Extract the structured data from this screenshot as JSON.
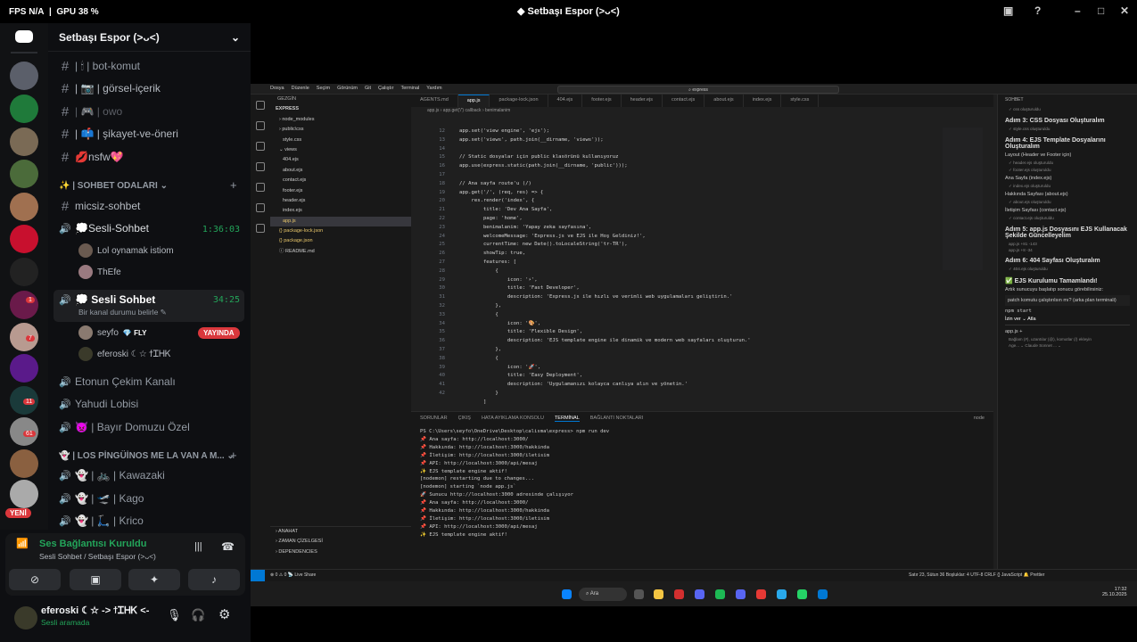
{
  "titlebar": {
    "fps_label": "FPS  N/A",
    "gpu_label": "GPU  38 %",
    "window_title": "Setbaşı Espor (>ᴗ<)"
  },
  "server": {
    "name": "Setbaşı Espor (>ᴗ<)",
    "badges": [
      "1",
      "7",
      "11",
      "61"
    ],
    "new_label": "YENİ"
  },
  "channels": {
    "text": [
      {
        "name": "| 🕯 | bot-komut",
        "dim": false
      },
      {
        "name": "| 📷 | görsel-içerik",
        "dim": false
      },
      {
        "name": "| 🎮 | owo",
        "dim": true
      },
      {
        "name": "| 📫 | şikayet-ve-öneri",
        "dim": false
      },
      {
        "name": "💋nsfw💖",
        "dim": false
      }
    ],
    "category1": "✨ | SOHBET ODALARI",
    "micsiz": "micsiz-sohbet",
    "voice1": {
      "name": "💭Sesli-Sohbet",
      "timer": "1:36:03",
      "users": [
        "Lol oynamak istiom",
        "ThEfe"
      ]
    },
    "voice2": {
      "name": "💭 Sesli Sohbet",
      "timer": "34:25",
      "status": "Bir kanal durumu belirle",
      "users": [
        {
          "name": "seyfo",
          "badge": "💎 FLY",
          "live": "YAYINDA"
        },
        {
          "name": "eferoski ☾☆ ϯᏆᎻᏦ"
        }
      ]
    },
    "others": [
      "Etonun Çekim Kanalı",
      "Yahudi Lobisi",
      "👿 | Bayır Domuzu Özel"
    ],
    "category2": "👻 | LOS PİNGÜİNOS ME LA VAN A M...",
    "pingu": [
      "👻 | 🚲 | Kawazaki",
      "👻 | 🛫 | Kago",
      "👻 | 🛴 | Krico"
    ]
  },
  "voice_panel": {
    "status": "Ses Bağlantısı Kuruldu",
    "channel": "Sesli Sohbet / Setbaşı Espor (>ᴗ<)"
  },
  "user": {
    "name": "eferoski ☾☆ -> ϯᏆᎻᏦ <-",
    "status": "Sesli aramada"
  },
  "vscode": {
    "menu": [
      "Dosya",
      "Düzenle",
      "Seçim",
      "Görünüm",
      "Git",
      "Çalıştır",
      "Terminal",
      "Yardım"
    ],
    "search": "express",
    "explorer_title": "GEZGİN",
    "tree": [
      "EXPRESS",
      "› node_modules",
      "› public\\css",
      "   style.css",
      "⌄ views",
      "   404.ejs",
      "   about.ejs",
      "   contact.ejs",
      "   footer.ejs",
      "   header.ejs",
      "   index.ejs",
      "app.js",
      "{} package-lock.json",
      "{} package.json",
      "ⓘ README.md"
    ],
    "outline": [
      "› ANAHAT",
      "› ZAMAN ÇİZELGESİ",
      "› DEPENDENCIES"
    ],
    "tabs": [
      "AGENTS.md",
      "app.js",
      "package-lock.json",
      "404.ejs",
      "footer.ejs",
      "header.ejs",
      "contact.ejs",
      "about.ejs",
      "index.ejs",
      "style.css"
    ],
    "breadcrumb": "app.js › app.get('/') callback › benimalanim",
    "line_numbers": "12\n13\n14\n15\n16\n17\n18\n19\n20\n21\n22\n23\n24\n25\n26\n27\n28\n29\n30\n31\n32\n33\n34\n35\n36\n37\n38\n39\n40\n41\n42",
    "code": "app.set('view engine', 'ejs');\napp.set('views', path.join(__dirname, 'views'));\n\n// Static dosyalar için public klasörünü kullanıyoruz\napp.use(express.static(path.join(__dirname, 'public')));\n\n// Ana sayfa route'u (/)\napp.get('/', (req, res) => {\n    res.render('index', {\n        title: 'Dev Ana Sayfa',\n        page: 'home',\n        benimalanim: 'Yapay zeka sayfasına',\n        welcomeMessage: 'Express.js ve EJS ile Hoş Geldiniz!',\n        currentTime: new Date().toLocaleString('tr-TR'),\n        showTip: true,\n        features: [\n            {\n                icon: '⚡',\n                title: 'Fast Developer',\n                description: 'Express.js ile hızlı ve verimli web uygulamaları geliştirin.'\n            },\n            {\n                icon: '🎨',\n                title: 'Flexible Design',\n                description: 'EJS template engine ile dinamik ve modern web sayfaları oluşturun.'\n            },\n            {\n                icon: '🚀',\n                title: 'Easy Deployment',\n                description: 'Uygulamanızı kolayca canlıya alın ve yönetin.'\n            }\n        ]",
    "terminal_tabs": [
      "SORUNLAR",
      "ÇIKIŞ",
      "HATA AYIKLAMA KONSOLU",
      "TERMİNAL",
      "BAĞLANTI NOKTALARI"
    ],
    "terminal_label": "node",
    "terminal": "PS C:\\Users\\seyfo\\OneDrive\\Desktop\\calisma\\express> npm run dev\n📌 Ana sayfa: http://localhost:3000/\n📌 Hakkında: http://localhost:3000/hakkinda\n📌 İletişim: http://localhost:3000/iletisim\n📌 API: http://localhost:3000/api/mesaj\n✨ EJS template engine aktif!\n[nodemon] restarting due to changes...\n[nodemon] starting `node app.js`\n🚀 Sunucu http://localhost:3000 adresinde çalışıyor\n📌 Ana sayfa: http://localhost:3000/\n📌 Hakkında: http://localhost:3000/hakkinda\n📌 İletişim: http://localhost:3000/iletisim\n📌 API: http://localhost:3000/api/mesaj\n✨ EJS template engine aktif!",
    "chat": {
      "title": "SOHBET",
      "items": [
        {
          "k": "s",
          "v": "✓  css   oluşturuldu"
        },
        {
          "k": "h",
          "v": "Adım 3: CSS Dosyası Oluşturalım"
        },
        {
          "k": "s",
          "v": "✓  style.css   oluşturuldu"
        },
        {
          "k": "h",
          "v": "Adım 4: EJS Template Dosyalarını Oluşturalım"
        },
        {
          "k": "t",
          "v": "Layout (Header ve Footer için)"
        },
        {
          "k": "s",
          "v": "✓  header.ejs   oluşturuldu"
        },
        {
          "k": "s",
          "v": "✓  footer.ejs   oluşturuldu"
        },
        {
          "k": "t",
          "v": "Ana Sayfa (index.ejs)"
        },
        {
          "k": "s",
          "v": "✓  index.ejs   oluşturuldu"
        },
        {
          "k": "t",
          "v": "Hakkında Sayfası (about.ejs)"
        },
        {
          "k": "s",
          "v": "✓  about.ejs   oluşturuldu"
        },
        {
          "k": "t",
          "v": "İletişim Sayfası (contact.ejs)"
        },
        {
          "k": "s",
          "v": "✓  contact.ejs   oluşturuldu"
        },
        {
          "k": "h",
          "v": "Adım 5: app.js Dosyasını EJS Kullanacak Şekilde Güncelleyelim"
        },
        {
          "k": "s",
          "v": "app.js  +81  -143"
        },
        {
          "k": "s",
          "v": "app.js  +8  -34"
        },
        {
          "k": "h",
          "v": "Adım 6: 404 Sayfası Oluşturalım"
        },
        {
          "k": "s",
          "v": "✓  404.ejs   oluşturuldu"
        },
        {
          "k": "h",
          "v": "✅ EJS Kurulumu Tamamlandı!"
        },
        {
          "k": "t",
          "v": "Artık sunucuyu başlatıp sonucu görebilirsiniz:"
        },
        {
          "k": "t",
          "v": "patch komutu çalıştırılsın mı? (arka plan terminali)"
        },
        {
          "k": "t",
          "v": "npm start"
        },
        {
          "k": "t",
          "v": "İzin ver ⌄   Atla"
        },
        {
          "k": "t",
          "v": "app.js  +"
        },
        {
          "k": "s",
          "v": "Bağlam (#), uzantılar (@), komutlar (/) ekleyin"
        },
        {
          "k": "s",
          "v": "Age... ⌄   Claude Sonnet ... ⌄"
        }
      ]
    },
    "status_left": "⊗ 0 ⚠ 0   📡 Live Share",
    "status_right": "Satır 23, Sütun 36   Boşluklar: 4   UTF-8   CRLF   {} JavaScript   🔔 Prettier"
  },
  "taskbar": {
    "search": "Ara",
    "time": "17:32",
    "date": "25.10.2025"
  }
}
